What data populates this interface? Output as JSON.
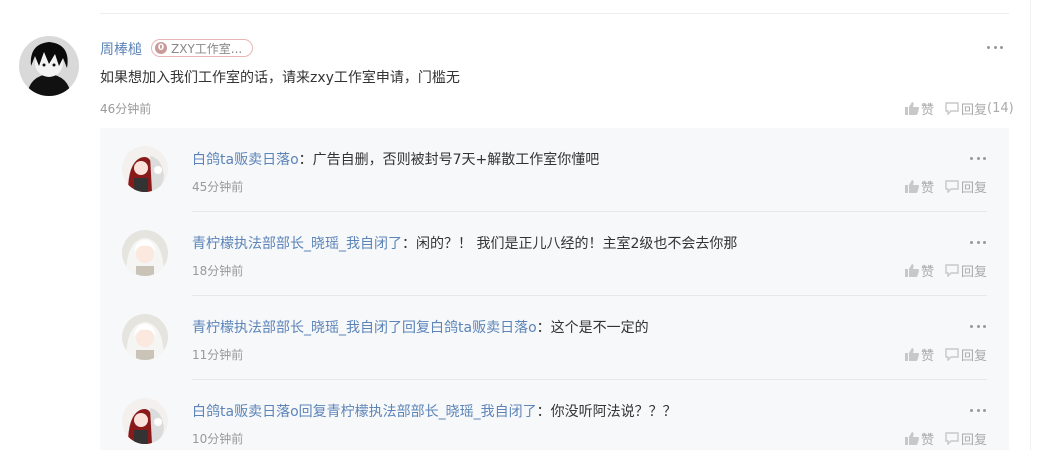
{
  "main_comment": {
    "username": "周棒槌",
    "badge": {
      "level": "0",
      "label": "ZXY工作室..."
    },
    "text": "如果想加入我们工作室的话，请来zxy工作室申请，门槛无",
    "time": "46分钟前",
    "like_label": "赞",
    "reply_label": "回复",
    "reply_count": "(14)",
    "avatar_icon": "dark-haired-boy-avatar"
  },
  "replies": [
    {
      "author": "白鸽ta贩卖日落o",
      "reply_word": "",
      "target": "",
      "separator": "：",
      "text": "广告自删，否则被封号7天+解散工作室你懂吧",
      "time": "45分钟前",
      "like_label": "赞",
      "reply_label": "回复",
      "avatar_icon": "red-haired-girl-avatar"
    },
    {
      "author": "青柠檬执法部部长_晓瑶_我自闭了",
      "reply_word": "",
      "target": "",
      "separator": "：",
      "text": "闲的？！ 我们是正儿八经的！主室2级也不会去你那",
      "time": "18分钟前",
      "like_label": "赞",
      "reply_label": "回复",
      "avatar_icon": "white-haired-girl-avatar"
    },
    {
      "author": "青柠檬执法部部长_晓瑶_我自闭了",
      "reply_word": "回复",
      "target": "白鸽ta贩卖日落o",
      "separator": "：",
      "text": "这个是不一定的",
      "time": "11分钟前",
      "like_label": "赞",
      "reply_label": "回复",
      "avatar_icon": "white-haired-girl-avatar"
    },
    {
      "author": "白鸽ta贩卖日落o",
      "reply_word": "回复",
      "target": "青柠檬执法部部长_晓瑶_我自闭了",
      "separator": "：",
      "text": "你没听阿法说？？？",
      "time": "10分钟前",
      "like_label": "赞",
      "reply_label": "回复",
      "avatar_icon": "red-haired-girl-avatar"
    }
  ],
  "colors": {
    "link": "#5c84b8",
    "muted": "#999999",
    "reply_bg": "#f7f8fa",
    "badge_border": "#e8b6b6"
  }
}
